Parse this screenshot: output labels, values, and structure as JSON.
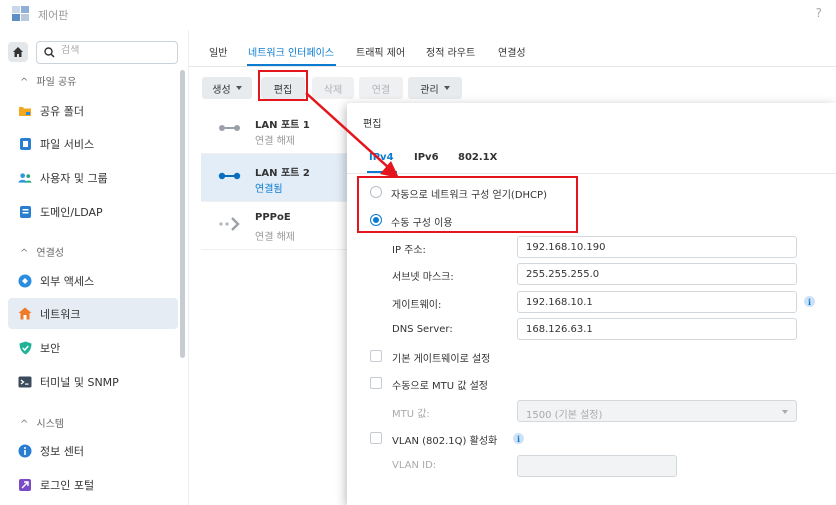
{
  "app": {
    "title": "제어판",
    "help": "?"
  },
  "sidebar": {
    "search_placeholder": "검색",
    "sections": [
      {
        "label": "파일 공유"
      },
      {
        "label": "연결성"
      },
      {
        "label": "시스템"
      }
    ],
    "items": [
      {
        "label": "공유 폴더",
        "icon": "folder-icon"
      },
      {
        "label": "파일 서비스",
        "icon": "file-services-icon"
      },
      {
        "label": "사용자 및 그룹",
        "icon": "users-icon"
      },
      {
        "label": "도메인/LDAP",
        "icon": "domain-icon"
      },
      {
        "label": "외부 액세스",
        "icon": "external-access-icon"
      },
      {
        "label": "네트워크",
        "icon": "network-icon",
        "active": true
      },
      {
        "label": "보안",
        "icon": "shield-icon"
      },
      {
        "label": "터미널 및 SNMP",
        "icon": "terminal-icon"
      },
      {
        "label": "정보 센터",
        "icon": "info-icon"
      },
      {
        "label": "로그인 포털",
        "icon": "login-portal-icon"
      }
    ]
  },
  "tabs": [
    "일반",
    "네트워크 인터페이스",
    "트래픽 제어",
    "정적 라우트",
    "연결성"
  ],
  "toolbar": {
    "create": "생성",
    "edit": "편집",
    "delete": "삭제",
    "connect": "연결",
    "manage": "관리"
  },
  "interfaces": [
    {
      "name": "LAN 포트 1",
      "status": "연결 해제"
    },
    {
      "name": "LAN 포트 2",
      "status": "연결됨"
    },
    {
      "name": "PPPoE",
      "status": "연결 해제"
    }
  ],
  "dialog": {
    "title": "편집",
    "tabs": [
      "IPv4",
      "IPv6",
      "802.1X"
    ],
    "options": {
      "dhcp": "자동으로 네트워크 구성 얻기(DHCP)",
      "manual": "수동 구성 이용"
    },
    "fields": {
      "ip_label": "IP 주소:",
      "ip_value": "192.168.10.190",
      "mask_label": "서브넷 마스크:",
      "mask_value": "255.255.255.0",
      "gw_label": "게이트웨이:",
      "gw_value": "192.168.10.1",
      "dns_label": "DNS Server:",
      "dns_value": "168.126.63.1"
    },
    "checks": {
      "default_gw": "기본 게이트웨이로 설정",
      "mtu_manual": "수동으로 MTU 값 설정",
      "mtu_label": "MTU 값:",
      "mtu_value": "1500 (기본 설정)",
      "vlan": "VLAN (802.1Q) 활성화",
      "vlan_id_label": "VLAN ID:",
      "vlan_id_value": ""
    }
  },
  "colors": {
    "accent": "#0a7bd1",
    "annotation": "#e4151d"
  }
}
